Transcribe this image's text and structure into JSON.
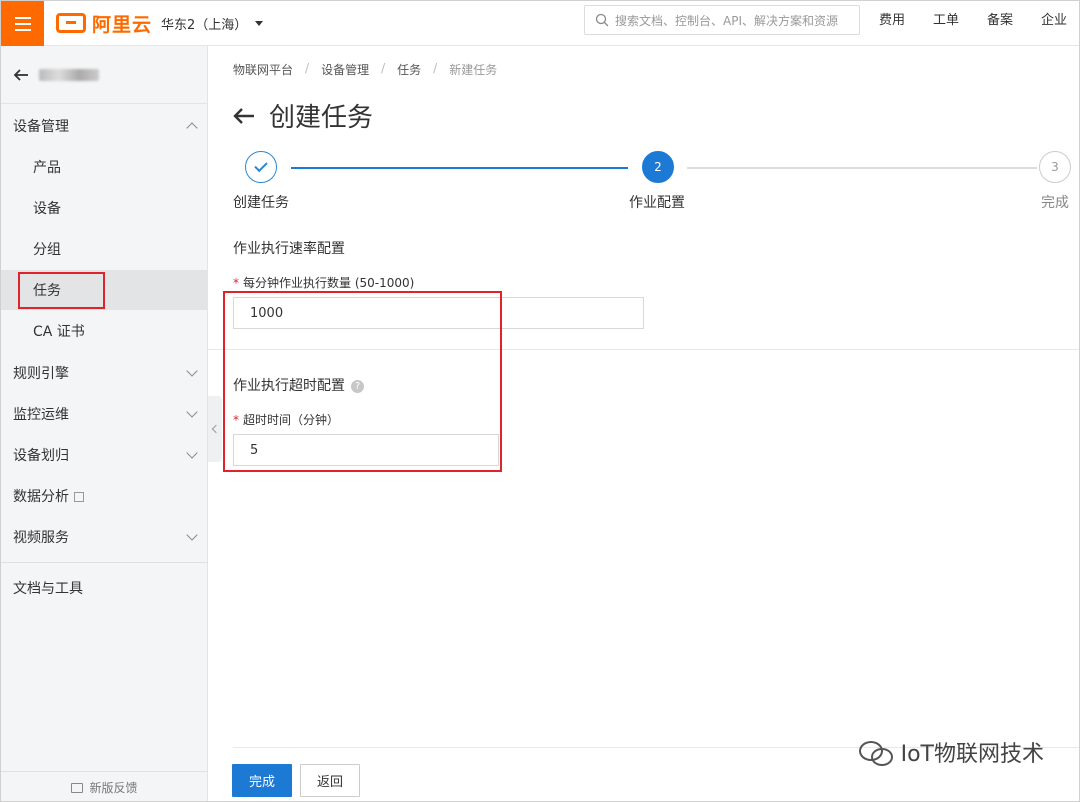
{
  "header": {
    "logo_text": "阿里云",
    "region": "华东2（上海）",
    "search_placeholder": "搜索文档、控制台、API、解决方案和资源",
    "nav": [
      "费用",
      "工单",
      "备案",
      "企业"
    ]
  },
  "sidebar": {
    "groups": {
      "device_mgmt": "设备管理",
      "rules": "规则引擎",
      "monitor": "监控运维",
      "device_assign": "设备划归",
      "data_analysis": "数据分析",
      "video": "视频服务",
      "docs": "文档与工具"
    },
    "sub_items": [
      "产品",
      "设备",
      "分组",
      "任务",
      "CA 证书"
    ],
    "feedback": "新版反馈"
  },
  "breadcrumb": [
    "物联网平台",
    "设备管理",
    "任务",
    "新建任务"
  ],
  "page_title": "创建任务",
  "steps": [
    {
      "number": "1",
      "label": "创建任务",
      "status": "done"
    },
    {
      "number": "2",
      "label": "作业配置",
      "status": "active"
    },
    {
      "number": "3",
      "label": "完成",
      "status": "todo"
    }
  ],
  "rate_section": {
    "title": "作业执行速率配置",
    "field_label": "每分钟作业执行数量 (50-1000)",
    "value": "1000"
  },
  "timeout_section": {
    "title": "作业执行超时配置",
    "help": "?",
    "field_label": "超时时间（分钟）",
    "value": "5"
  },
  "buttons": {
    "finish": "完成",
    "back": "返回"
  },
  "watermark": "IoT物联网技术",
  "colors": {
    "brand_orange": "#ff6a00",
    "primary_blue": "#1c7ad5",
    "highlight_red": "#e0222b"
  }
}
